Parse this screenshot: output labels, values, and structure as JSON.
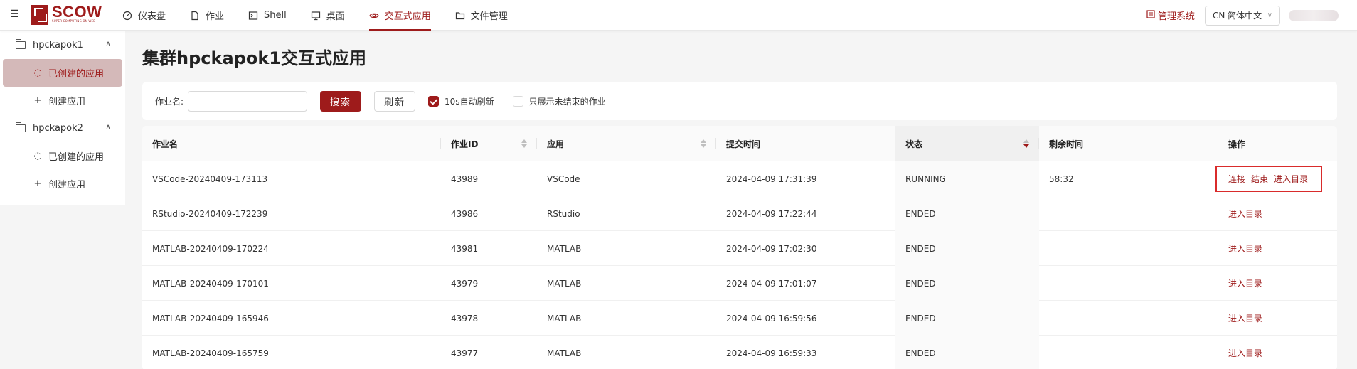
{
  "header": {
    "menu_icon": "menu-icon",
    "logo": {
      "title": "SCOW",
      "subtitle": "SUPER COMPUTING ON WEB"
    },
    "nav": [
      {
        "label": "仪表盘",
        "icon": "dashboard-icon",
        "active": false
      },
      {
        "label": "作业",
        "icon": "file-icon",
        "active": false
      },
      {
        "label": "Shell",
        "icon": "terminal-icon",
        "active": false
      },
      {
        "label": "桌面",
        "icon": "desktop-icon",
        "active": false
      },
      {
        "label": "交互式应用",
        "icon": "eye-icon",
        "active": true
      },
      {
        "label": "文件管理",
        "icon": "folder-icon",
        "active": false
      }
    ],
    "admin_label": "管理系统",
    "language": "CN 简体中文"
  },
  "sidebar": {
    "groups": [
      {
        "label": "hpckapok1",
        "items": [
          {
            "label": "已创建的应用",
            "icon": "loading-icon",
            "active": true
          },
          {
            "label": "创建应用",
            "icon": "plus-icon",
            "active": false
          }
        ]
      },
      {
        "label": "hpckapok2",
        "items": [
          {
            "label": "已创建的应用",
            "icon": "loading-icon",
            "active": false
          },
          {
            "label": "创建应用",
            "icon": "plus-icon",
            "active": false
          }
        ]
      }
    ]
  },
  "main": {
    "title": "集群hpckapok1交互式应用",
    "filter": {
      "label": "作业名:",
      "input_value": "",
      "search_label": "搜索",
      "refresh_label": "刷新",
      "auto_refresh_label": "10s自动刷新",
      "auto_refresh_checked": true,
      "unfinished_only_label": "只展示未结束的作业",
      "unfinished_only_checked": false
    },
    "table": {
      "headers": [
        "作业名",
        "作业ID",
        "应用",
        "提交时间",
        "状态",
        "剩余时间",
        "操作"
      ],
      "rows": [
        {
          "name": "VSCode-20240409-173113",
          "id": "43989",
          "app": "VSCode",
          "submit": "2024-04-09 17:31:39",
          "status": "RUNNING",
          "remaining": "58:32",
          "actions": [
            "连接",
            "结束",
            "进入目录"
          ]
        },
        {
          "name": "RStudio-20240409-172239",
          "id": "43986",
          "app": "RStudio",
          "submit": "2024-04-09 17:22:44",
          "status": "ENDED",
          "remaining": "",
          "actions": [
            "进入目录"
          ]
        },
        {
          "name": "MATLAB-20240409-170224",
          "id": "43981",
          "app": "MATLAB",
          "submit": "2024-04-09 17:02:30",
          "status": "ENDED",
          "remaining": "",
          "actions": [
            "进入目录"
          ]
        },
        {
          "name": "MATLAB-20240409-170101",
          "id": "43979",
          "app": "MATLAB",
          "submit": "2024-04-09 17:01:07",
          "status": "ENDED",
          "remaining": "",
          "actions": [
            "进入目录"
          ]
        },
        {
          "name": "MATLAB-20240409-165946",
          "id": "43978",
          "app": "MATLAB",
          "submit": "2024-04-09 16:59:56",
          "status": "ENDED",
          "remaining": "",
          "actions": [
            "进入目录"
          ]
        },
        {
          "name": "MATLAB-20240409-165759",
          "id": "43977",
          "app": "MATLAB",
          "submit": "2024-04-09 16:59:33",
          "status": "ENDED",
          "remaining": "",
          "actions": [
            "进入目录"
          ]
        }
      ]
    }
  },
  "colors": {
    "brand": "#9e1b1b",
    "highlight": "#d92b2b"
  }
}
